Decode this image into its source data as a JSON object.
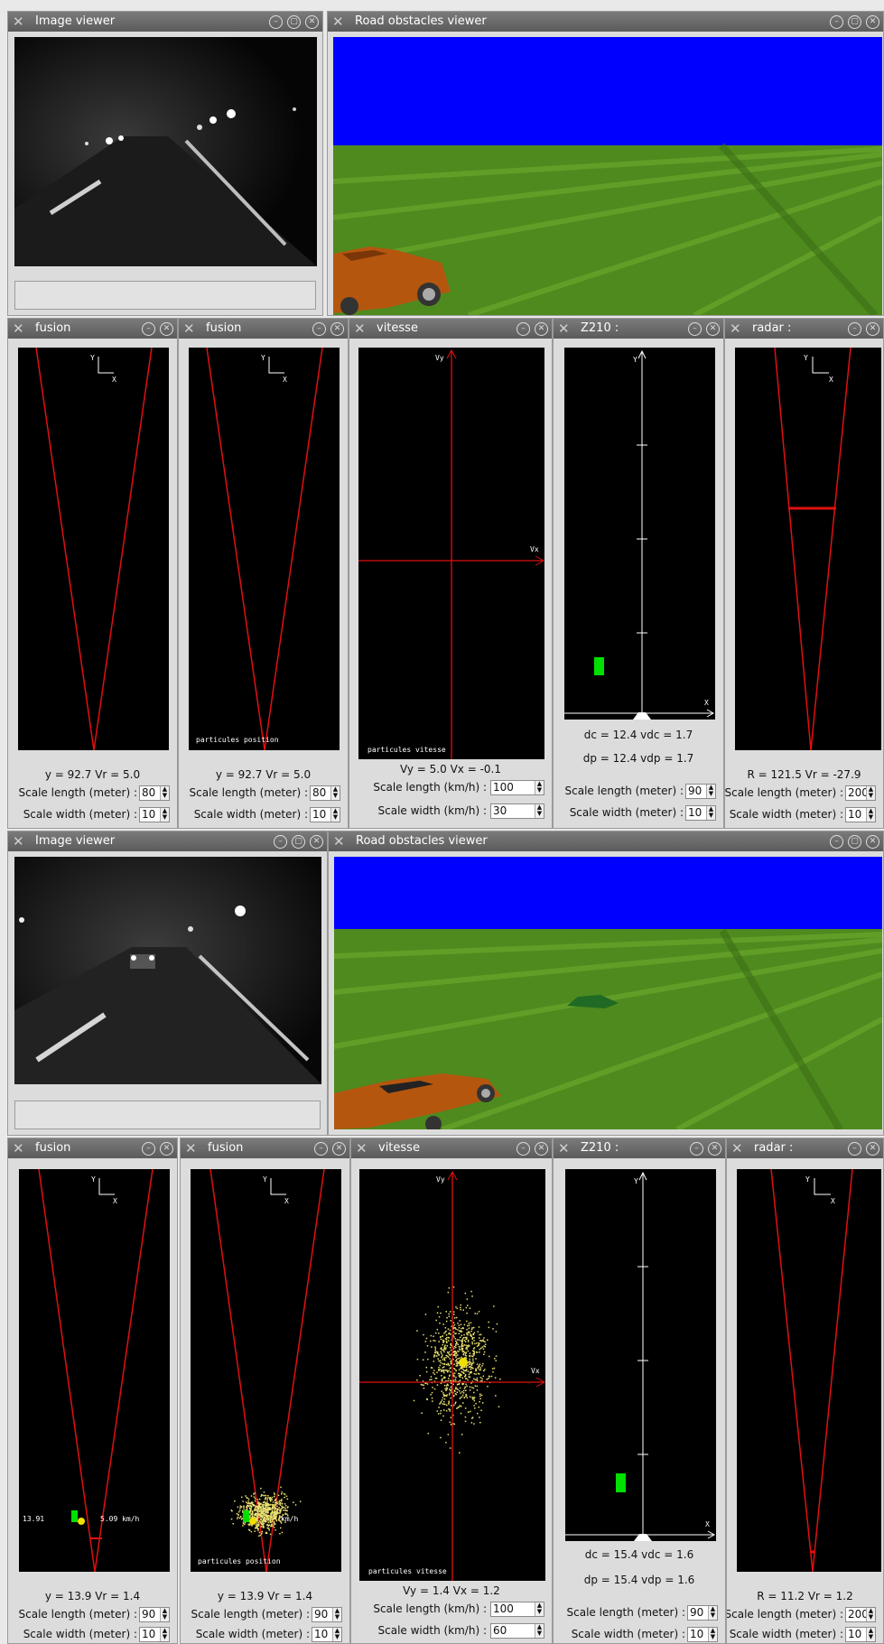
{
  "top": {
    "image_viewer": {
      "title": "Image viewer"
    },
    "road_viewer": {
      "title": "Road obstacles viewer"
    },
    "fusion1": {
      "title": "fusion",
      "readout": "y = 92.7  Vr = 5.0",
      "scale_length_label": "Scale length (meter) :",
      "scale_length": "80",
      "scale_width_label": "Scale width (meter) :",
      "scale_width": "10"
    },
    "fusion2": {
      "title": "fusion",
      "readout": "y = 92.7  Vr = 5.0",
      "overlay": "particules position",
      "scale_length_label": "Scale length (meter) :",
      "scale_length": "80",
      "scale_width_label": "Scale width (meter) :",
      "scale_width": "10"
    },
    "vitesse": {
      "title": "vitesse",
      "axis_y": "Vy",
      "axis_x": "Vx",
      "overlay": "particules vitesse",
      "readout": "Vy = 5.0  Vx = -0.1",
      "scale_length_label": "Scale length (km/h) :",
      "scale_length": "100",
      "scale_width_label": "Scale width (km/h) :",
      "scale_width": "30"
    },
    "z210": {
      "title": "Z210 :",
      "axis_y": "Y",
      "axis_x": "X",
      "readout1": "dc = 12.4  vdc = 1.7",
      "readout2": "dp = 12.4  vdp = 1.7",
      "scale_length_label": "Scale length (meter) :",
      "scale_length": "90",
      "scale_width_label": "Scale width (meter) :",
      "scale_width": "10"
    },
    "radar": {
      "title": "radar :",
      "readout": "R = 121.5  Vr = -27.9",
      "scale_length_label": "Scale length (meter) :",
      "scale_length": "200",
      "scale_width_label": "Scale width (meter) :",
      "scale_width": "10"
    }
  },
  "bottom": {
    "image_viewer": {
      "title": "Image viewer"
    },
    "road_viewer": {
      "title": "Road obstacles viewer"
    },
    "fusion1": {
      "title": "fusion",
      "readout": "y = 13.9  Vr = 1.4",
      "label_left": "13.91",
      "label_right": "5.09 km/h",
      "scale_length_label": "Scale length (meter) :",
      "scale_length": "90",
      "scale_width_label": "Scale width (meter) :",
      "scale_width": "10"
    },
    "fusion2": {
      "title": "fusion",
      "readout": "y = 13.9  Vr = 1.4",
      "overlay": "particules position",
      "label_right": "km/h",
      "scale_length_label": "Scale length (meter) :",
      "scale_length": "90",
      "scale_width_label": "Scale width (meter) :",
      "scale_width": "10"
    },
    "vitesse": {
      "title": "vitesse",
      "axis_y": "Vy",
      "axis_x": "Vx",
      "overlay": "particules vitesse",
      "readout": "Vy = 1.4  Vx = 1.2",
      "scale_length_label": "Scale length (km/h) :",
      "scale_length": "100",
      "scale_width_label": "Scale width (km/h) :",
      "scale_width": "60"
    },
    "z210": {
      "title": "Z210 :",
      "axis_y": "Y",
      "axis_x": "X",
      "readout1": "dc = 15.4  vdc = 1.6",
      "readout2": "dp = 15.4  vdp = 1.6",
      "scale_length_label": "Scale length (meter) :",
      "scale_length": "90",
      "scale_width_label": "Scale width (meter) :",
      "scale_width": "10"
    },
    "radar": {
      "title": "radar :",
      "readout": "R = 11.2  Vr = 1.2",
      "scale_length_label": "Scale length (meter) :",
      "scale_length": "200",
      "scale_width_label": "Scale width (meter) :",
      "scale_width": "10"
    }
  },
  "colors": {
    "sky": "#0000ff",
    "grass": "#4e8a1e",
    "car_main": "#b5560f",
    "car_obstacle": "#1f6a24",
    "beam": "#e01010",
    "target": "#00e000",
    "particle": "#e8e070"
  }
}
